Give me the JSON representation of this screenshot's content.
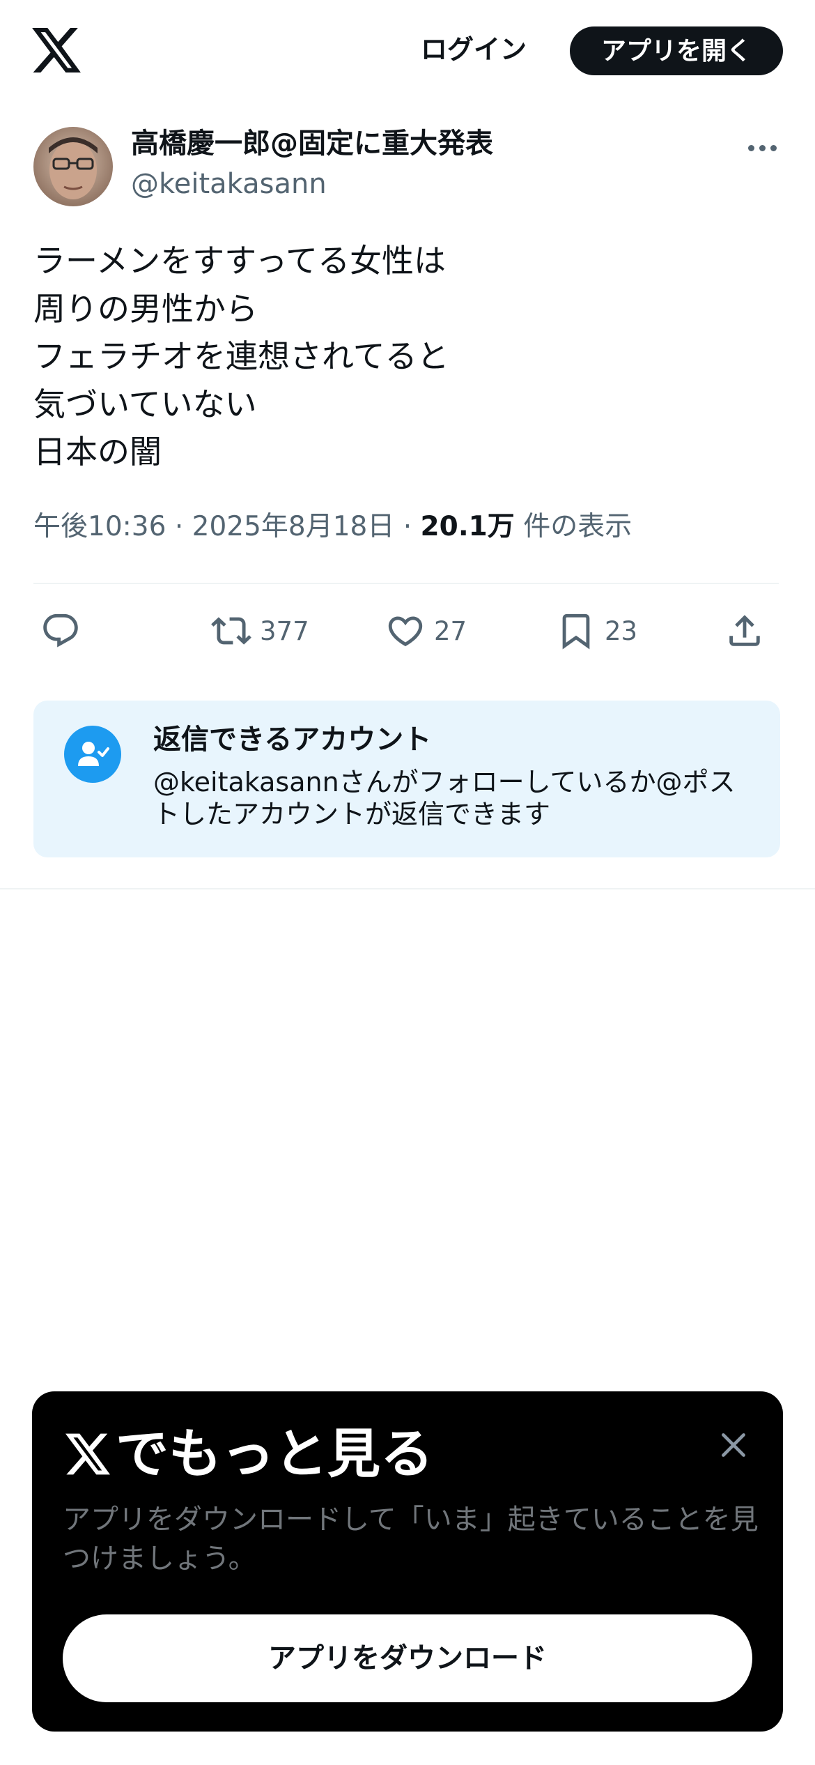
{
  "header": {
    "logo_icon": "x-logo-icon",
    "login_label": "ログイン",
    "open_app_label": "アプリを開く"
  },
  "author": {
    "name": "高橋慶一郎@固定に重大発表",
    "handle": "@keitakasann",
    "more_icon": "more-horizontal-icon"
  },
  "tweet": {
    "lines": [
      "ラーメンをすすってる女性は",
      "周りの男性から",
      "フェラチオを連想されてると",
      "気づいていない",
      "日本の闇"
    ],
    "time": "午後10:36",
    "separator": "·",
    "date": "2025年8月18日",
    "views_count": "20.1万",
    "views_label": "件の表示"
  },
  "actions": {
    "reply": {
      "icon": "reply-icon",
      "count": ""
    },
    "retweet": {
      "icon": "retweet-icon",
      "count": "377"
    },
    "like": {
      "icon": "heart-icon",
      "count": "27"
    },
    "bookmark": {
      "icon": "bookmark-icon",
      "count": "23"
    },
    "share": {
      "icon": "share-icon"
    }
  },
  "reply_restriction": {
    "icon": "person-check-icon",
    "title": "返信できるアカウント",
    "description": "@keitakasannさんがフォローしているか@ポストしたアカウントが返信できます"
  },
  "bottom_sheet": {
    "title": "でもっと見る",
    "description": "アプリをダウンロードして「いま」起きていることを見つけましょう。",
    "download_label": "アプリをダウンロード",
    "close_icon": "close-icon"
  },
  "colors": {
    "text_primary": "#0f1419",
    "text_secondary": "#536471",
    "accent_blue": "#1d9bf0",
    "card_background": "#e8f5fd",
    "sheet_background": "#000000"
  }
}
